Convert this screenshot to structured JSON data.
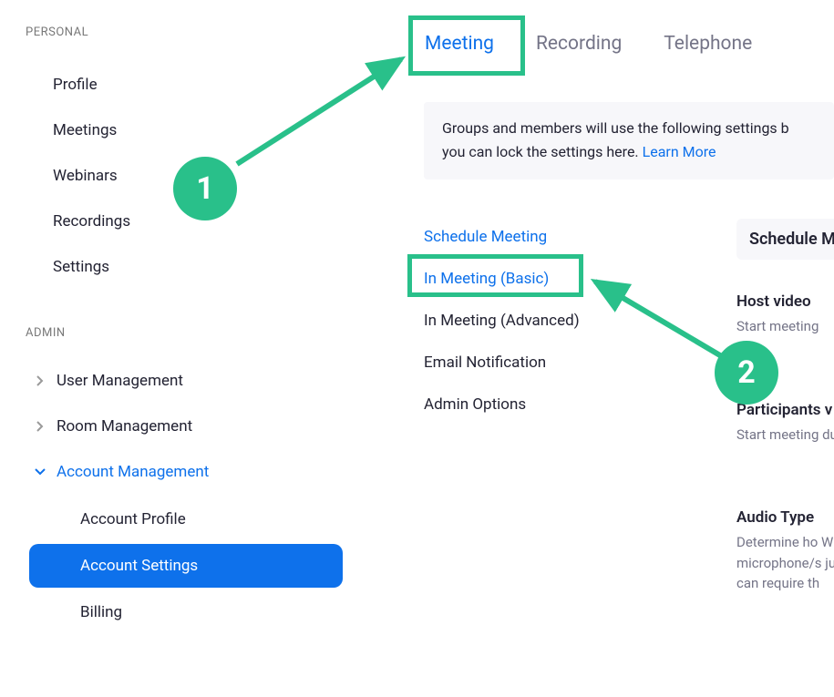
{
  "sidebar": {
    "personal_label": "PERSONAL",
    "personal_items": [
      "Profile",
      "Meetings",
      "Webinars",
      "Recordings",
      "Settings"
    ],
    "admin_label": "ADMIN",
    "admin_items": [
      {
        "label": "User Management",
        "expanded": false
      },
      {
        "label": "Room Management",
        "expanded": false
      },
      {
        "label": "Account Management",
        "expanded": true
      }
    ],
    "account_mgmt_sub": [
      "Account Profile",
      "Account Settings",
      "Billing"
    ],
    "account_mgmt_active": "Account Settings"
  },
  "tabs": [
    "Meeting",
    "Recording",
    "Telephone"
  ],
  "active_tab": "Meeting",
  "info_text_1": "Groups and members will use the following settings b",
  "info_text_2": "you can lock the settings here. ",
  "info_link": "Learn More",
  "subnav": [
    {
      "label": "Schedule Meeting",
      "link": true
    },
    {
      "label": "In Meeting (Basic)",
      "link": true
    },
    {
      "label": "In Meeting (Advanced)",
      "link": false
    },
    {
      "label": "Email Notification",
      "link": false
    },
    {
      "label": "Admin Options",
      "link": false
    }
  ],
  "right": {
    "heading": "Schedule Me",
    "settings": [
      {
        "title": "Host video",
        "desc": "Start meeting"
      },
      {
        "title": "Participants v",
        "desc": "Start meeting during the me"
      },
      {
        "title": "Audio Type",
        "desc": "Determine ho When joining microphone/s just one of th can require th"
      }
    ]
  },
  "annotations": {
    "step1": "1",
    "step2": "2"
  }
}
